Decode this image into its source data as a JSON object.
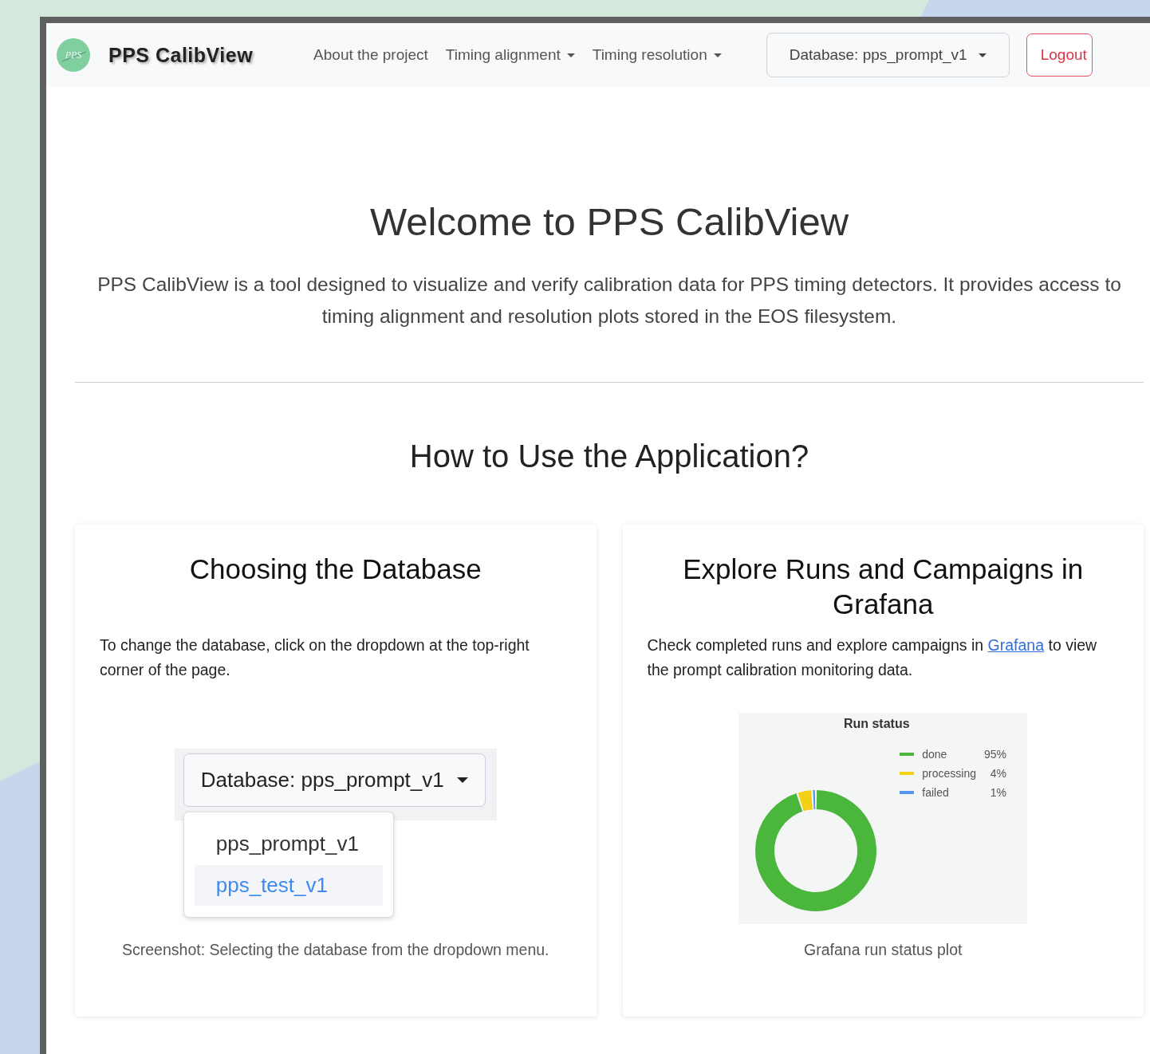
{
  "navbar": {
    "logo_text": "PPS",
    "brand": "PPS CalibView",
    "links": [
      {
        "label": "About the project",
        "dropdown": false
      },
      {
        "label": "Timing alignment",
        "dropdown": true
      },
      {
        "label": "Timing resolution",
        "dropdown": true
      }
    ],
    "database_button": "Database: pps_prompt_v1",
    "logout_button": "Logout"
  },
  "hero": {
    "title": "Welcome to PPS CalibView",
    "description": "PPS CalibView is a tool designed to visualize and verify calibration data for PPS timing detectors. It provides access to timing alignment and resolution plots stored in the EOS filesystem."
  },
  "section_title": "How to Use the Application?",
  "cards": [
    {
      "kind": "dropdown-screenshot",
      "title": "Choosing the Database",
      "text": "To change the database, click on the dropdown at the top-right corner of the page.",
      "screenshot": {
        "button": "Database: pps_prompt_v1",
        "options": [
          {
            "label": "pps_prompt_v1",
            "selected": false
          },
          {
            "label": "pps_test_v1",
            "selected": true
          }
        ]
      },
      "caption": "Screenshot: Selecting the database from the dropdown menu."
    },
    {
      "kind": "chart",
      "title": "Explore Runs and Campaigns in Grafana",
      "text_before": "Check completed runs and explore campaigns in ",
      "link": "Grafana",
      "text_after": " to view the prompt calibration monitoring data.",
      "chart_data": {
        "type": "donut",
        "title": "Run status",
        "categories": [
          "done",
          "processing",
          "failed"
        ],
        "values": [
          95,
          4,
          1
        ],
        "value_labels": [
          "95%",
          "4%",
          "1%"
        ],
        "colors": [
          "#4ab63c",
          "#f5cf14",
          "#5794f2"
        ],
        "legend": "right"
      },
      "caption": "Grafana run status plot"
    }
  ]
}
